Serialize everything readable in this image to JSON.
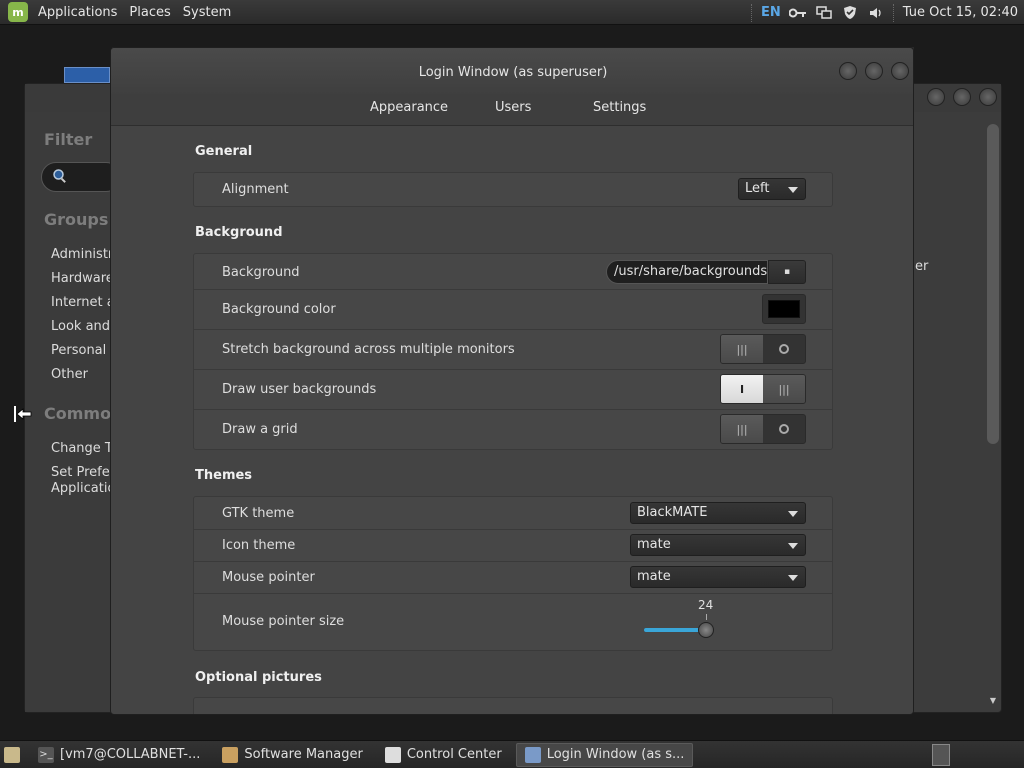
{
  "top_panel": {
    "menu": [
      "Applications",
      "Places",
      "System"
    ],
    "lang": "EN",
    "clock": "Tue Oct 15, 02:40",
    "tray_icons": [
      "key-icon",
      "network-icon",
      "shield-icon",
      "volume-icon"
    ]
  },
  "control_center": {
    "filter_heading": "Filter",
    "groups_heading": "Groups",
    "groups": [
      "Administra",
      "Hardware",
      "Internet ar",
      "Look and I",
      "Personal",
      "Other"
    ],
    "common_heading": "Common",
    "common_items": [
      "Change Th",
      "Set Prefere",
      "Applicatio"
    ],
    "partial_text": "er"
  },
  "dialog": {
    "title": "Login Window (as superuser)",
    "tabs": [
      "Appearance",
      "Users",
      "Settings"
    ],
    "sections": {
      "general": "General",
      "background": "Background",
      "themes": "Themes",
      "optional_pictures": "Optional pictures"
    },
    "general": {
      "alignment_label": "Alignment",
      "alignment_value": "Left"
    },
    "background": {
      "background_label": "Background",
      "background_path": "/usr/share/backgrounds/",
      "color_label": "Background color",
      "color_value": "#000000",
      "stretch_label": "Stretch background across multiple monitors",
      "stretch_on": false,
      "user_bg_label": "Draw user backgrounds",
      "user_bg_on": true,
      "grid_label": "Draw a grid",
      "grid_on": false
    },
    "themes": {
      "gtk_label": "GTK theme",
      "gtk_value": "BlackMATE",
      "icon_label": "Icon theme",
      "icon_value": "mate",
      "pointer_label": "Mouse pointer",
      "pointer_value": "mate",
      "pointer_size_label": "Mouse pointer size",
      "pointer_size_value": "24"
    }
  },
  "taskbar": {
    "tasks": [
      "[vm7@COLLABNET-...",
      "Software Manager",
      "Control Center",
      "Login Window (as s..."
    ]
  },
  "colors": {
    "accent": "#3aa6d8",
    "mint_green": "#87b64a"
  }
}
